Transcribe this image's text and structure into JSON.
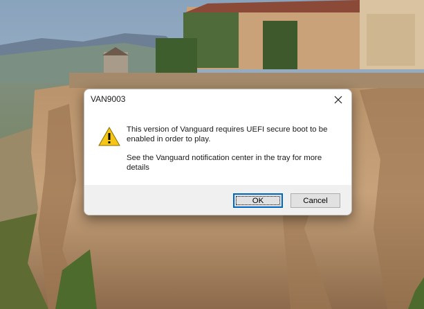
{
  "dialog": {
    "title": "VAN9003",
    "message_line1": "This version of Vanguard requires UEFI secure boot to be enabled in order to play.",
    "message_line2": "See the Vanguard notification center in the tray for more details",
    "ok_label": "OK",
    "cancel_label": "Cancel",
    "icon": "warning-icon",
    "close_icon": "close-icon"
  },
  "colors": {
    "warning_yellow": "#f5c518",
    "ok_border": "#0067c0",
    "dialog_bg": "#f0f0f0"
  }
}
